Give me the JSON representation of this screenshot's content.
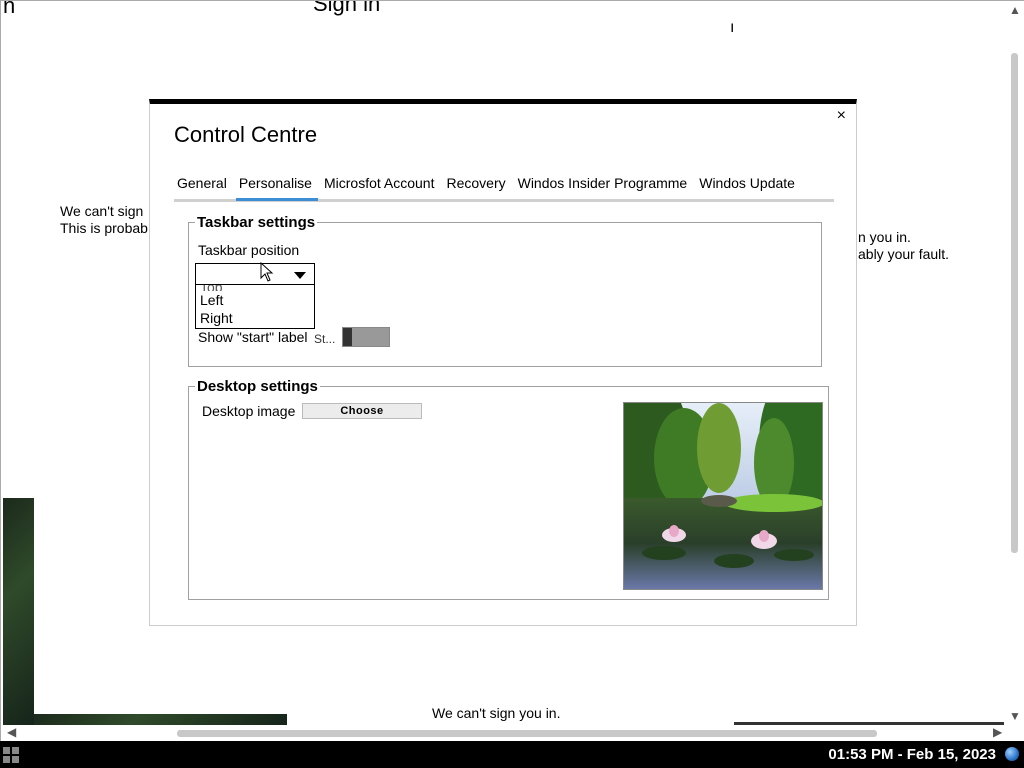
{
  "background": {
    "title_partial": "Sign in",
    "left_message": [
      "We can't sign",
      "This is probab"
    ],
    "right_message": [
      "n you in.",
      "ably your fault."
    ],
    "bottom_message": "We can't sign you in."
  },
  "dialog": {
    "title": "Control Centre",
    "close_label": "×",
    "tabs": [
      {
        "label": "General"
      },
      {
        "label": "Personalise",
        "active": true
      },
      {
        "label": "Microsfot Account"
      },
      {
        "label": "Recovery"
      },
      {
        "label": "Windos Insider Programme"
      },
      {
        "label": "Windos Update"
      }
    ],
    "taskbar_settings": {
      "legend": "Taskbar settings",
      "position_label": "Taskbar position",
      "position_value": "",
      "position_options": [
        "Top",
        "Left",
        "Right"
      ],
      "show_start_label": "Show \"start\" label",
      "toggle_caption": "St...",
      "show_start_on": false
    },
    "desktop_settings": {
      "legend": "Desktop settings",
      "image_label": "Desktop image",
      "choose_label": "Choose"
    }
  },
  "taskbar": {
    "clock": "01:53 PM - Feb 15, 2023"
  }
}
